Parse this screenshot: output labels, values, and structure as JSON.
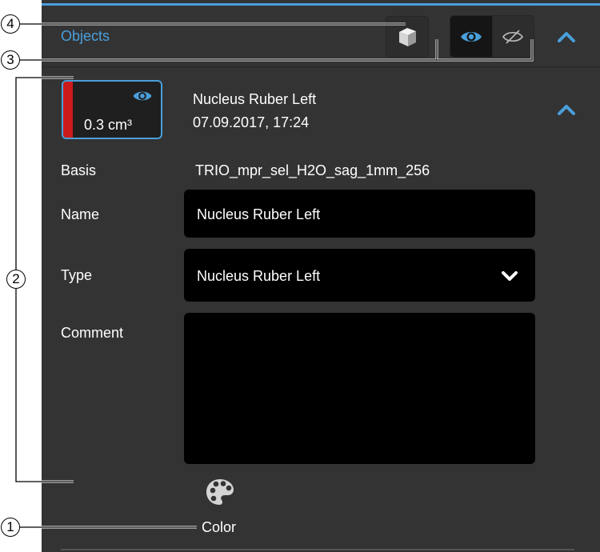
{
  "header": {
    "title": "Objects"
  },
  "object": {
    "volume": "0.3 cm³",
    "name": "Nucleus Ruber Left",
    "date": "07.09.2017, 17:24",
    "stripe_color": "#cc1b1b"
  },
  "details": {
    "basis_label": "Basis",
    "basis_value": "TRIO_mpr_sel_H2O_sag_1mm_256",
    "name_label": "Name",
    "name_value": "Nucleus Ruber Left",
    "type_label": "Type",
    "type_value": "Nucleus Ruber Left",
    "comment_label": "Comment",
    "comment_value": ""
  },
  "color": {
    "label": "Color"
  },
  "callouts": [
    "1",
    "2",
    "3",
    "4"
  ],
  "accent_color": "#4a9fdb"
}
